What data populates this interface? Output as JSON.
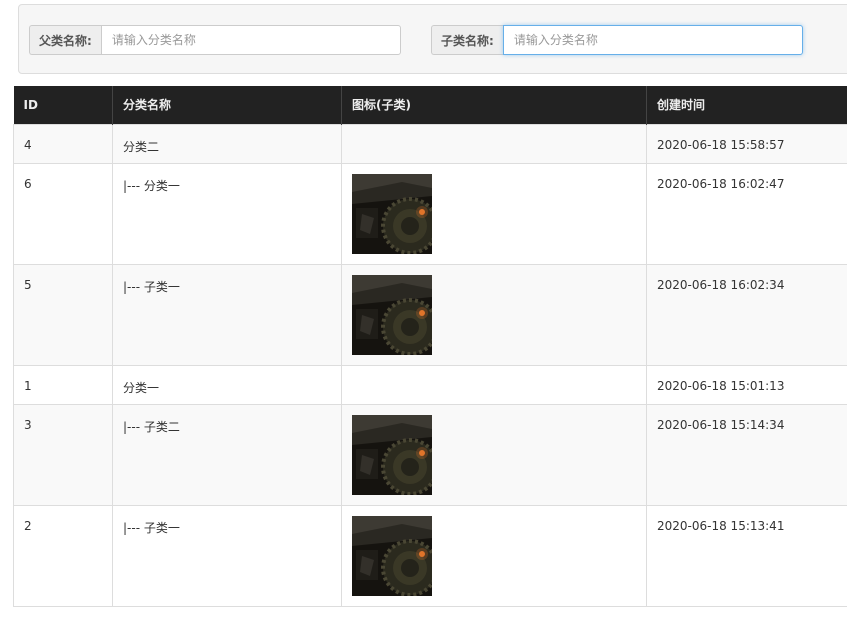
{
  "search": {
    "parent": {
      "label": "父类名称:",
      "placeholder": "请输入分类名称",
      "value": ""
    },
    "child": {
      "label": "子类名称:",
      "placeholder": "请输入分类名称",
      "value": ""
    }
  },
  "table": {
    "headers": [
      "ID",
      "分类名称",
      "图标(子类)",
      "创建时间"
    ],
    "rows": [
      {
        "id": "4",
        "name": "分类二",
        "has_icon": false,
        "created": "2020-06-18 15:58:57"
      },
      {
        "id": "6",
        "name": "|--- 分类一",
        "has_icon": true,
        "icon": "wheel-photo",
        "created": "2020-06-18 16:02:47"
      },
      {
        "id": "5",
        "name": "|--- 子类一",
        "has_icon": true,
        "icon": "wheel-photo",
        "created": "2020-06-18 16:02:34"
      },
      {
        "id": "1",
        "name": "分类一",
        "has_icon": false,
        "created": "2020-06-18 15:01:13"
      },
      {
        "id": "3",
        "name": "|--- 子类二",
        "has_icon": true,
        "icon": "wheel-photo",
        "created": "2020-06-18 15:14:34"
      },
      {
        "id": "2",
        "name": "|--- 子类一",
        "has_icon": true,
        "icon": "wheel-photo",
        "created": "2020-06-18 15:13:41"
      }
    ]
  },
  "colors": {
    "header_bg": "#222222",
    "header_text": "#eeeeee",
    "stripe": "#f9f9f9",
    "focus_border": "#66afe9"
  }
}
